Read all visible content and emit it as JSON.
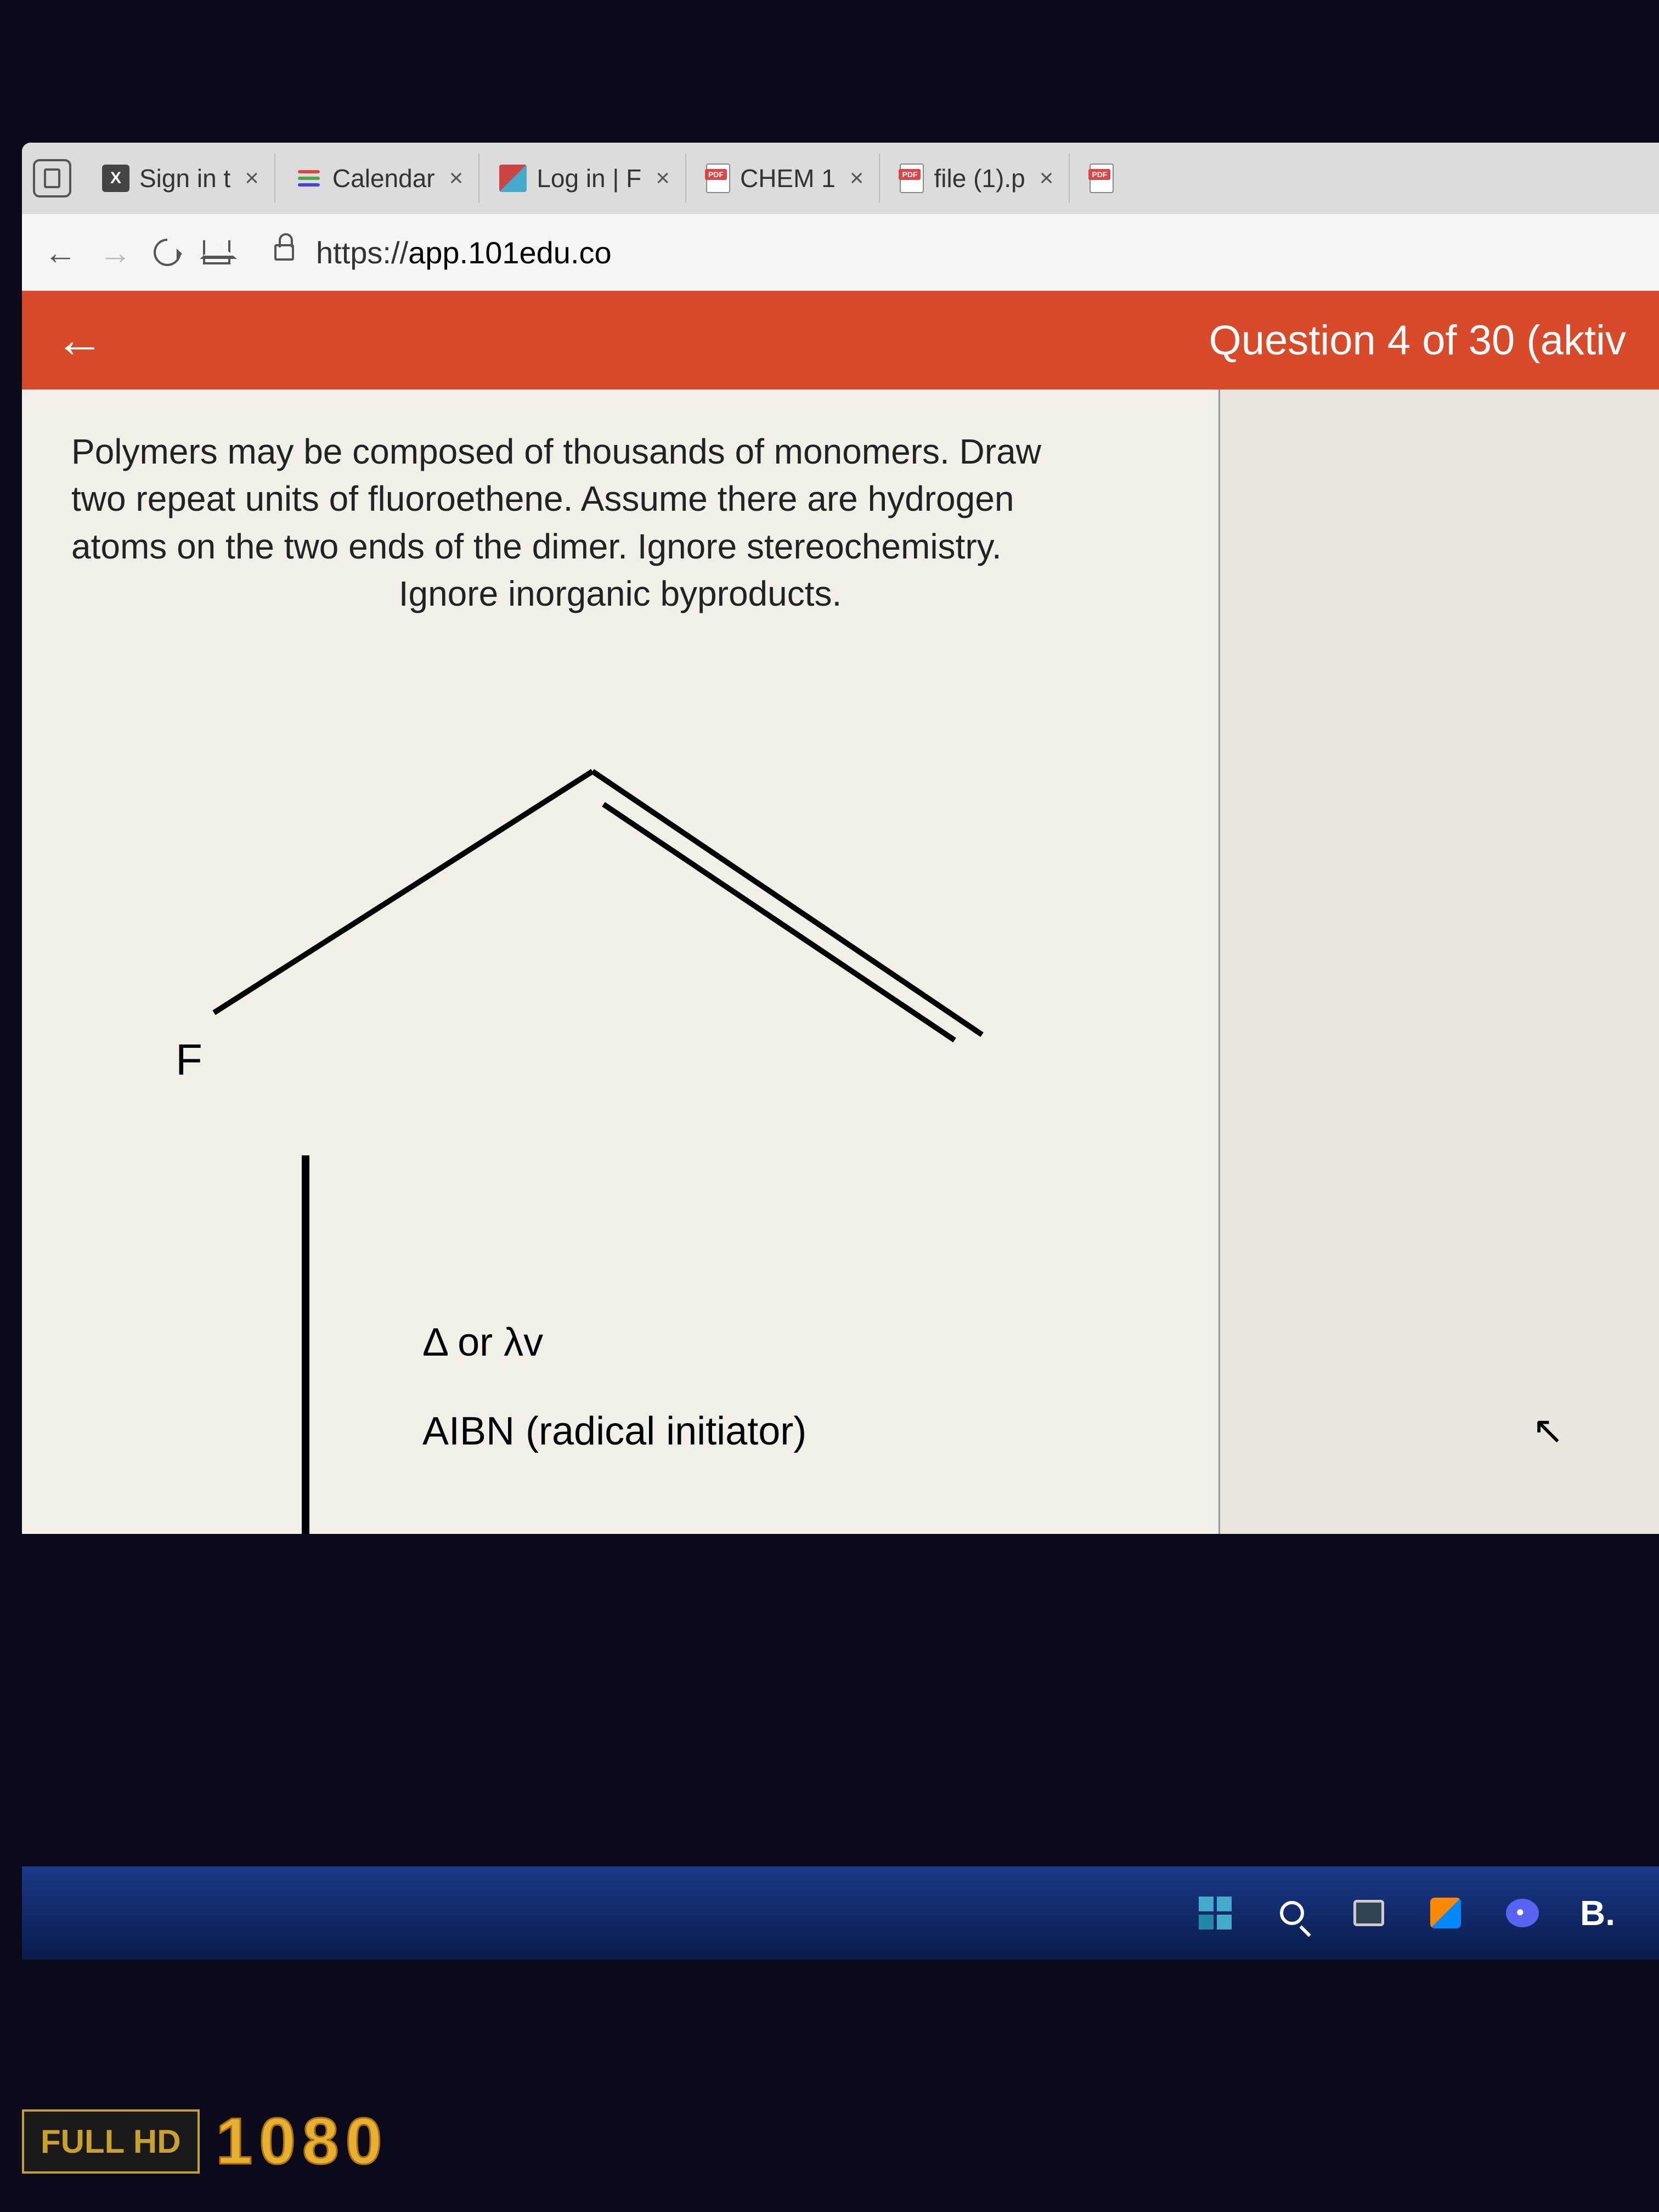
{
  "tabs": [
    {
      "label": "Sign in t",
      "icon": "x"
    },
    {
      "label": "Calendar",
      "icon": "lines"
    },
    {
      "label": "Log in | F",
      "icon": "diamond"
    },
    {
      "label": "CHEM 1",
      "icon": "pdf"
    },
    {
      "label": "file (1).p",
      "icon": "pdf"
    }
  ],
  "url": {
    "protocol": "https://",
    "domain": "app.101edu.co"
  },
  "app": {
    "question_title": "Question 4 of 30 (aktiv"
  },
  "question": {
    "line1": "Polymers may be composed of thousands of monomers. Draw",
    "line2": "two repeat units of fluoroethene. Assume there are hydrogen",
    "line3": "atoms on the two ends of the dimer. Ignore stereochemistry.",
    "line4": "Ignore inorganic byproducts."
  },
  "molecule": {
    "atom_label": "F"
  },
  "reaction": {
    "condition1": "Δ or λv",
    "condition2": "AIBN (radical initiator)"
  },
  "taskbar": {
    "b_label": "B."
  },
  "monitor": {
    "badge": "FULL HD",
    "text": "1080"
  }
}
